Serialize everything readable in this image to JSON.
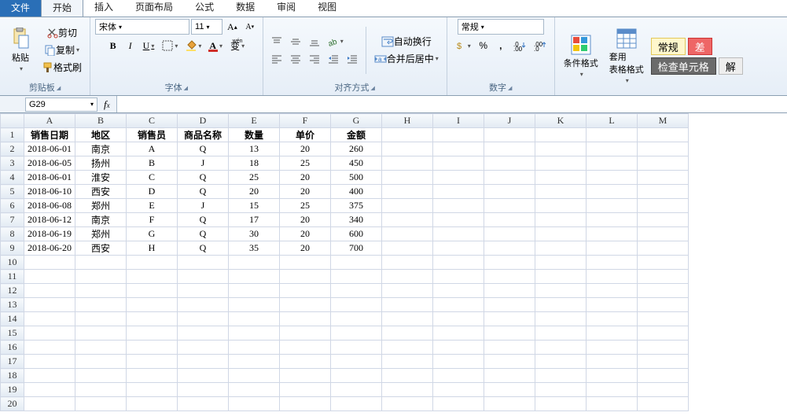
{
  "tabs": {
    "file": "文件",
    "items": [
      "开始",
      "插入",
      "页面布局",
      "公式",
      "数据",
      "审阅",
      "视图"
    ],
    "active_index": 0
  },
  "ribbon": {
    "clipboard": {
      "paste": "粘贴",
      "cut": "剪切",
      "copy": "复制",
      "format_painter": "格式刷",
      "group": "剪贴板"
    },
    "font": {
      "name": "宋体",
      "size": "11",
      "bold": "B",
      "italic": "I",
      "underline": "U",
      "group": "字体",
      "furigana": "变",
      "furigana2": "wén"
    },
    "align": {
      "wrap": "自动换行",
      "merge": "合并后居中",
      "group": "对齐方式"
    },
    "number": {
      "format": "常规",
      "group": "数字"
    },
    "styles": {
      "cond": "条件格式",
      "table": "套用\n表格格式",
      "normal": "常规",
      "check": "检查单元格",
      "bad": "差",
      "explain": "解"
    }
  },
  "name_box": "G29",
  "formula": "",
  "columns": [
    "A",
    "B",
    "C",
    "D",
    "E",
    "F",
    "G",
    "H",
    "I",
    "J",
    "K",
    "L",
    "M"
  ],
  "row_count": 20,
  "headers": [
    "销售日期",
    "地区",
    "销售员",
    "商品名称",
    "数量",
    "单价",
    "金额"
  ],
  "rows": [
    [
      "2018-06-01",
      "南京",
      "A",
      "Q",
      "13",
      "20",
      "260"
    ],
    [
      "2018-06-05",
      "扬州",
      "B",
      "J",
      "18",
      "25",
      "450"
    ],
    [
      "2018-06-01",
      "淮安",
      "C",
      "Q",
      "25",
      "20",
      "500"
    ],
    [
      "2018-06-10",
      "西安",
      "D",
      "Q",
      "20",
      "20",
      "400"
    ],
    [
      "2018-06-08",
      "郑州",
      "E",
      "J",
      "15",
      "25",
      "375"
    ],
    [
      "2018-06-12",
      "南京",
      "F",
      "Q",
      "17",
      "20",
      "340"
    ],
    [
      "2018-06-19",
      "郑州",
      "G",
      "Q",
      "30",
      "20",
      "600"
    ],
    [
      "2018-06-20",
      "西安",
      "H",
      "Q",
      "35",
      "20",
      "700"
    ]
  ],
  "chart_data": {
    "type": "table",
    "columns": [
      "销售日期",
      "地区",
      "销售员",
      "商品名称",
      "数量",
      "单价",
      "金额"
    ],
    "rows": [
      [
        "2018-06-01",
        "南京",
        "A",
        "Q",
        13,
        20,
        260
      ],
      [
        "2018-06-05",
        "扬州",
        "B",
        "J",
        18,
        25,
        450
      ],
      [
        "2018-06-01",
        "淮安",
        "C",
        "Q",
        25,
        20,
        500
      ],
      [
        "2018-06-10",
        "西安",
        "D",
        "Q",
        20,
        20,
        400
      ],
      [
        "2018-06-08",
        "郑州",
        "E",
        "J",
        15,
        25,
        375
      ],
      [
        "2018-06-12",
        "南京",
        "F",
        "Q",
        17,
        20,
        340
      ],
      [
        "2018-06-19",
        "郑州",
        "G",
        "Q",
        30,
        20,
        600
      ],
      [
        "2018-06-20",
        "西安",
        "H",
        "Q",
        35,
        20,
        700
      ]
    ]
  }
}
